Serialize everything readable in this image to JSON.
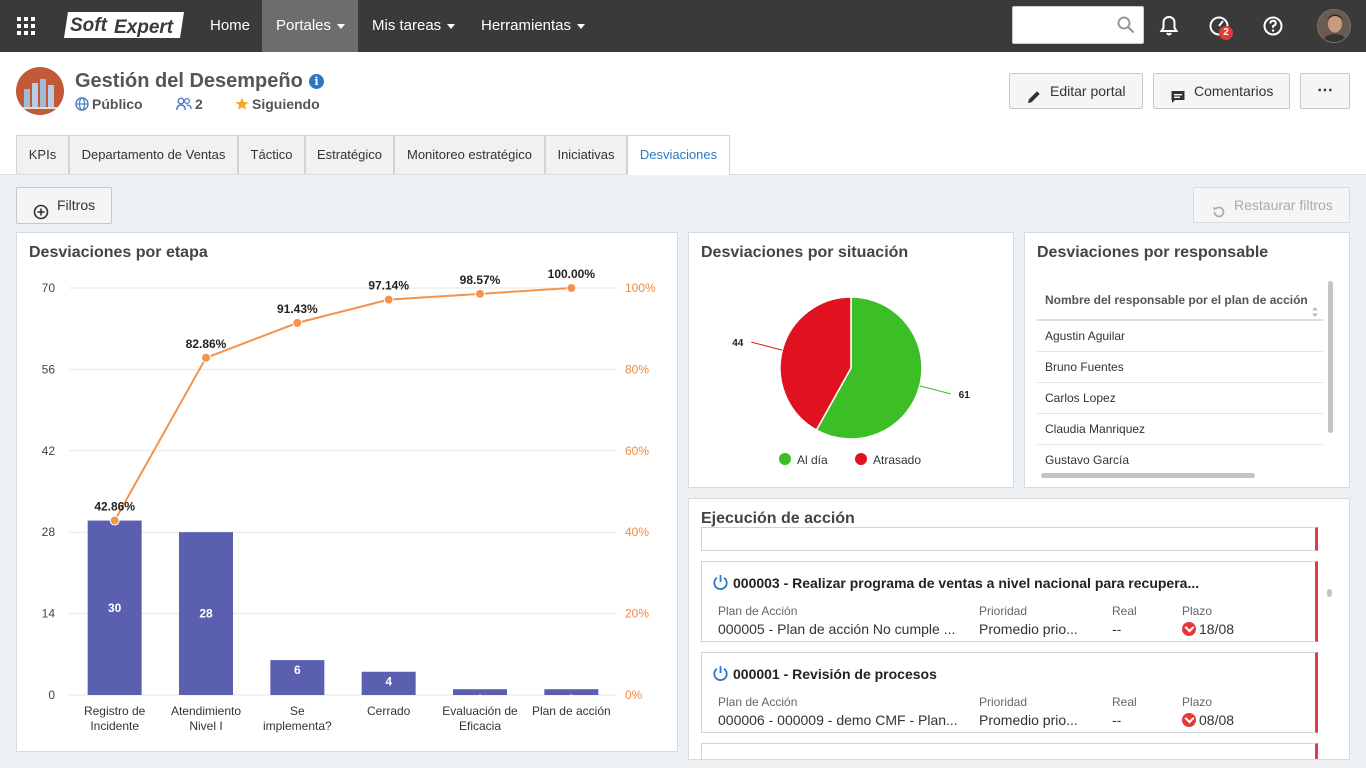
{
  "topbar": {
    "nav": [
      {
        "label": "Home",
        "dropdown": false,
        "active": false
      },
      {
        "label": "Portales",
        "dropdown": true,
        "active": true
      },
      {
        "label": "Mis tareas",
        "dropdown": true,
        "active": false
      },
      {
        "label": "Herramientas",
        "dropdown": true,
        "active": false
      }
    ],
    "logo_text": "SoftExpert",
    "search_placeholder": "",
    "notification_badge": "2"
  },
  "header": {
    "title": "Gestión del Desempeño",
    "visibility": "Público",
    "members": "2",
    "follow": "Siguiendo",
    "edit_label": "Editar portal",
    "comments_label": "Comentarios",
    "more_label": "⋯"
  },
  "tabs": [
    {
      "label": "KPIs"
    },
    {
      "label": "Departamento de Ventas"
    },
    {
      "label": "Táctico"
    },
    {
      "label": "Estratégico"
    },
    {
      "label": "Monitoreo estratégico"
    },
    {
      "label": "Iniciativas"
    },
    {
      "label": "Desviaciones",
      "active": true
    }
  ],
  "filters": {
    "filter_label": "Filtros",
    "restore_label": "Restaurar filtros"
  },
  "panels": {
    "etapa_title": "Desviaciones por etapa",
    "situacion_title": "Desviaciones por situación",
    "responsable_title": "Desviaciones por responsable",
    "ejecucion_title": "Ejecución de acción"
  },
  "chart_data": [
    {
      "type": "bar",
      "title": "Desviaciones por etapa",
      "categories": [
        "Registro de Incidente",
        "Atendimiento Nivel I",
        "Se implementa?",
        "Cerrado",
        "Evaluación de Eficacia",
        "Plan de acción"
      ],
      "category_lines": [
        [
          "Registro de",
          "Incidente"
        ],
        [
          "Atendimiento",
          "Nivel I"
        ],
        [
          "Se",
          "implementa?"
        ],
        [
          "Cerrado"
        ],
        [
          "Evaluación de",
          "Eficacia"
        ],
        [
          "Plan de acción"
        ]
      ],
      "series": [
        {
          "type": "bar",
          "values": [
            30,
            28,
            6,
            4,
            1,
            1
          ],
          "color": "#5b5faf"
        },
        {
          "type": "line",
          "values": [
            42.86,
            82.86,
            91.43,
            97.14,
            98.57,
            100.0
          ],
          "labels": [
            "42.86%",
            "82.86%",
            "91.43%",
            "97.14%",
            "98.57%",
            "100.00%"
          ],
          "color": "#f4934e"
        }
      ],
      "ylim": [
        0,
        70
      ],
      "yticks": [
        "0",
        "14",
        "28",
        "42",
        "56",
        "70"
      ],
      "y2lim": [
        0,
        100
      ],
      "y2ticks": [
        "0%",
        "20%",
        "40%",
        "60%",
        "80%",
        "100%"
      ],
      "grid": true
    },
    {
      "type": "pie",
      "title": "Desviaciones por situación",
      "categories": [
        "Al día",
        "Atrasado"
      ],
      "values": [
        61,
        44
      ],
      "labels": [
        "61",
        "44"
      ],
      "colors": [
        "#3cbf26",
        "#e0121f"
      ],
      "legend": "bottom"
    }
  ],
  "responsable": {
    "column_header": "Nombre del responsable por el plan de acción",
    "rows": [
      "Agustin Aguilar",
      "Bruno Fuentes",
      "Carlos Lopez",
      "Claudia Manriquez",
      "Gustavo García"
    ]
  },
  "actions": {
    "field_labels": {
      "plan": "Plan de Acción",
      "prioridad": "Prioridad",
      "real": "Real",
      "plazo": "Plazo"
    },
    "cards": [
      {
        "title": "000003 - Realizar programa de ventas a nivel nacional para recupera...",
        "plan": "000005 - Plan de acción No cumple ...",
        "prioridad": "Promedio prio...",
        "real": "--",
        "plazo": "18/08"
      },
      {
        "title": "000001 - Revisión de procesos",
        "plan": "000006 - 000009 - demo CMF - Plan...",
        "prioridad": "Promedio prio...",
        "real": "--",
        "plazo": "08/08"
      }
    ]
  }
}
